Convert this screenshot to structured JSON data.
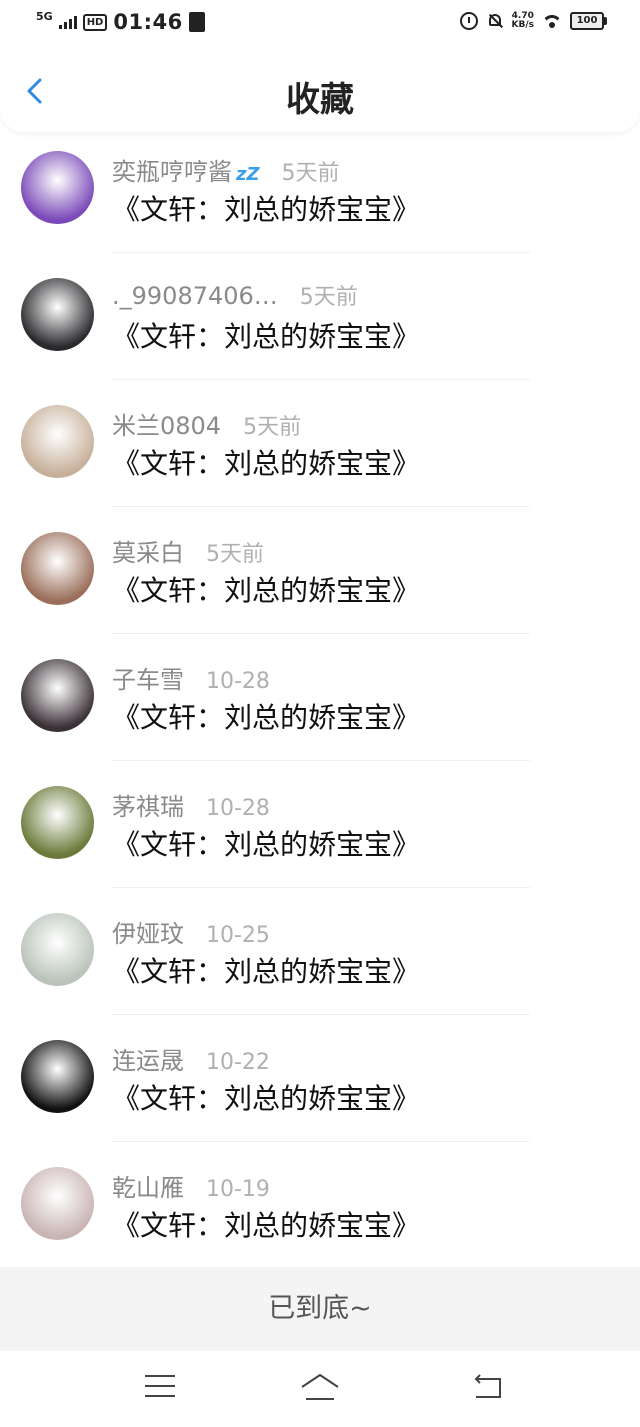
{
  "status_bar": {
    "network": "5G",
    "hd": "HD",
    "time": "01:46",
    "speed_value": "4.70",
    "speed_unit": "KB/s",
    "battery": "100"
  },
  "header": {
    "title": "收藏"
  },
  "items": [
    {
      "name": "奕瓶哼哼酱",
      "time": "5天前",
      "title": "《文轩：刘总的娇宝宝》",
      "avatar_color": "#7b4ab8",
      "badge": "zZ"
    },
    {
      "name": "._99087406…",
      "time": "5天前",
      "title": "《文轩：刘总的娇宝宝》",
      "avatar_color": "#2a2a2e"
    },
    {
      "name": "米兰0804",
      "time": "5天前",
      "title": "《文轩：刘总的娇宝宝》",
      "avatar_color": "#c7b09a"
    },
    {
      "name": "莫采白",
      "time": "5天前",
      "title": "《文轩：刘总的娇宝宝》",
      "avatar_color": "#9a6e5a"
    },
    {
      "name": "子车雪",
      "time": "10-28",
      "title": "《文轩：刘总的娇宝宝》",
      "avatar_color": "#3a3036"
    },
    {
      "name": "茅祺瑞",
      "time": "10-28",
      "title": "《文轩：刘总的娇宝宝》",
      "avatar_color": "#6b7a3a"
    },
    {
      "name": "伊娅玟",
      "time": "10-25",
      "title": "《文轩：刘总的娇宝宝》",
      "avatar_color": "#b9c3b9"
    },
    {
      "name": "连运晟",
      "time": "10-22",
      "title": "《文轩：刘总的娇宝宝》",
      "avatar_color": "#111111"
    },
    {
      "name": "乾山雁",
      "time": "10-19",
      "title": "《文轩：刘总的娇宝宝》",
      "avatar_color": "#c9b4b4"
    }
  ],
  "footer": {
    "end_text": "已到底~"
  },
  "colors": {
    "accent": "#2f8ae5",
    "name_text": "#8a8a8a",
    "time_text": "#b0b0b0",
    "title_text": "#111111"
  },
  "icons": {
    "back": "chevron-left-icon",
    "menu": "menu-icon",
    "home": "home-icon",
    "return": "return-icon"
  }
}
